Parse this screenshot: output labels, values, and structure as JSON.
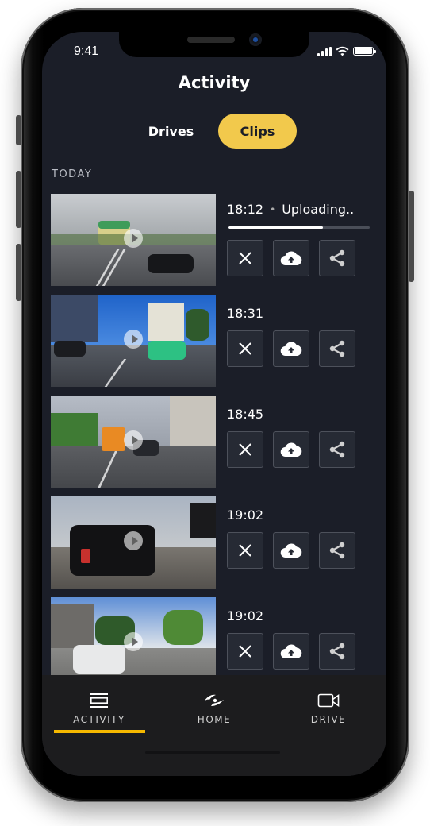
{
  "status_bar": {
    "time": "9:41",
    "icons": [
      "cellular-signal-icon",
      "wifi-icon",
      "battery-icon"
    ]
  },
  "header": {
    "title": "Activity"
  },
  "segmented_tabs": [
    {
      "label": "Drives",
      "active": false
    },
    {
      "label": "Clips",
      "active": true
    }
  ],
  "section": {
    "label": "TODAY"
  },
  "clips": [
    {
      "time": "18:12",
      "status": "Uploading..",
      "upload_progress": 0.67,
      "thumbnail": "street-intersection-green-house-dark-car"
    },
    {
      "time": "18:31",
      "thumbnail": "sunny-street-green-car"
    },
    {
      "time": "18:45",
      "thumbnail": "bus-lane-tram-orange-van"
    },
    {
      "time": "19:02",
      "thumbnail": "black-suv-overcast-street"
    },
    {
      "time": "19:02",
      "thumbnail": "white-taxi-crosswalk"
    }
  ],
  "clip_actions": [
    {
      "name": "delete",
      "icon": "close-icon"
    },
    {
      "name": "upload",
      "icon": "cloud-upload-icon"
    },
    {
      "name": "share",
      "icon": "share-icon"
    }
  ],
  "bottom_nav": [
    {
      "label": "ACTIVITY",
      "icon": "activity-icon",
      "active": true
    },
    {
      "label": "HOME",
      "icon": "home-logo-icon",
      "active": false
    },
    {
      "label": "DRIVE",
      "icon": "video-camera-icon",
      "active": false
    }
  ],
  "colors": {
    "accent": "#f2c94c",
    "nav_active_underline": "#f5b800",
    "screen_background": "#1b1e28",
    "nav_background": "#1c1c1e"
  }
}
